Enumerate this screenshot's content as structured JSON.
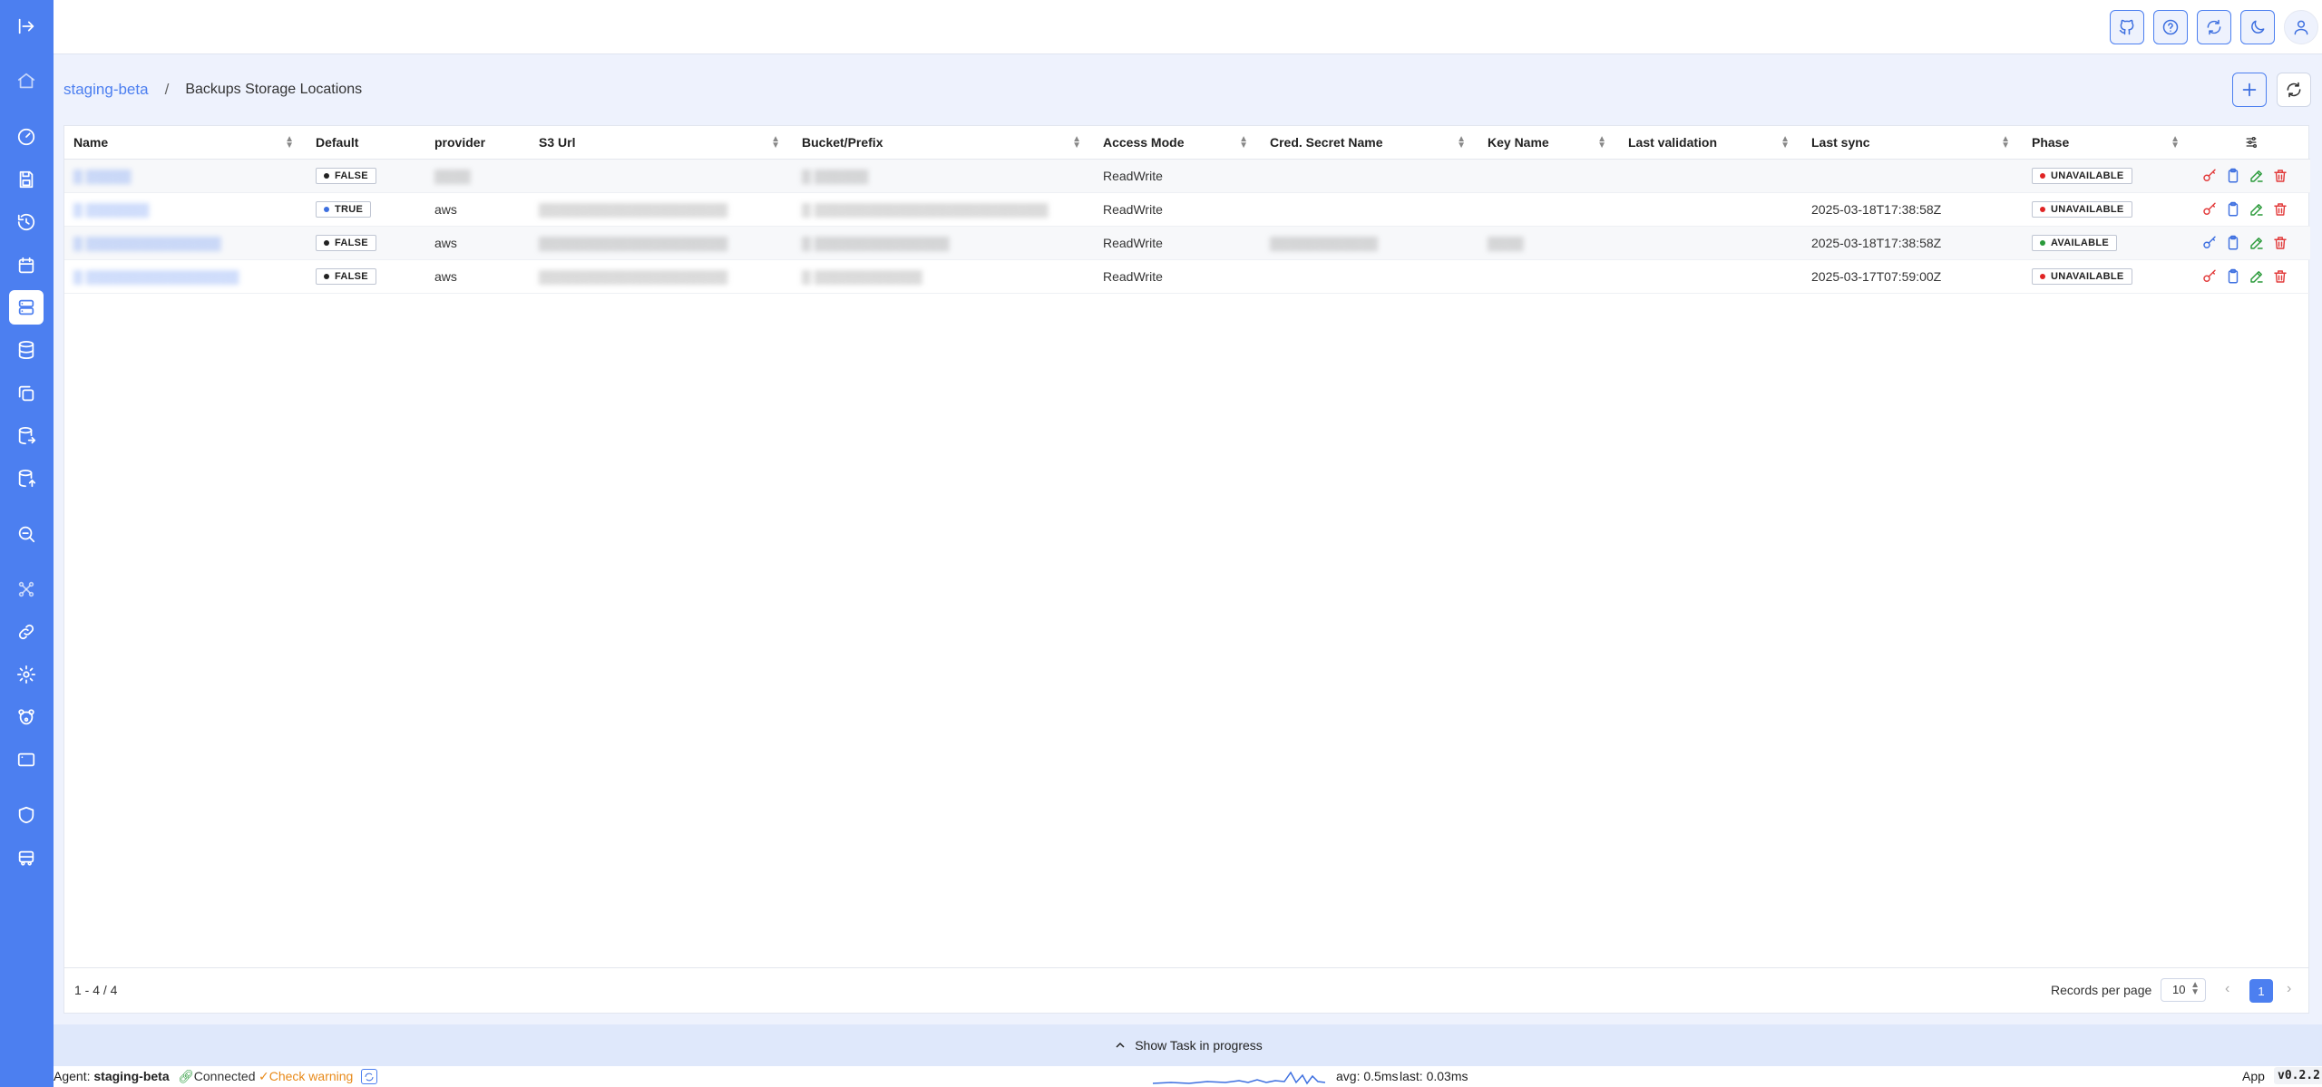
{
  "sidebar": {
    "items": [
      {
        "icon": "collapse-sidebar-icon"
      },
      {
        "icon": "home-icon"
      },
      {
        "icon": "dashboard-gauge-icon"
      },
      {
        "icon": "backup-save-icon"
      },
      {
        "icon": "restore-history-icon"
      },
      {
        "icon": "schedule-calendar-icon"
      },
      {
        "icon": "storage-locations-icon",
        "active": true
      },
      {
        "icon": "database-icon"
      },
      {
        "icon": "copies-icon"
      },
      {
        "icon": "database-export-icon"
      },
      {
        "icon": "database-import-icon"
      },
      {
        "icon": "inspect-search-icon"
      },
      {
        "icon": "network-nodes-icon"
      },
      {
        "icon": "link-icon"
      },
      {
        "icon": "settings-gear-icon"
      },
      {
        "icon": "bear-icon"
      },
      {
        "icon": "window-icon"
      },
      {
        "icon": "shield-icon"
      },
      {
        "icon": "vehicle-icon"
      }
    ]
  },
  "topbar": {
    "buttons": [
      "heart-icon",
      "github-icon",
      "help-icon",
      "sync-icon",
      "dark-mode-icon",
      "user-icon"
    ]
  },
  "breadcrumb": {
    "cluster": "staging-beta",
    "separator": "/",
    "page": "Backups Storage Locations"
  },
  "table": {
    "columns": [
      "Name",
      "Default",
      "provider",
      "S3 Url",
      "Bucket/Prefix",
      "Access Mode",
      "Cred. Secret Name",
      "Key Name",
      "Last validation",
      "Last sync",
      "Phase"
    ],
    "rows": [
      {
        "name": "▒ ▒▒▒▒▒",
        "default": "FALSE",
        "provider": "▒▒▒▒",
        "s3url": "",
        "bucket": "▒ ▒▒▒▒▒▒",
        "access": "ReadWrite",
        "cred": "",
        "key": "",
        "last_validation": "",
        "last_sync": "",
        "phase": "UNAVAILABLE"
      },
      {
        "name": "▒ ▒▒▒▒▒▒▒",
        "default": "TRUE",
        "provider": "aws",
        "s3url": "▒▒▒▒▒▒▒▒▒▒▒▒▒▒▒▒▒▒▒▒▒",
        "bucket": "▒ ▒▒▒▒▒▒▒▒▒▒▒▒▒▒▒▒▒▒▒▒▒▒▒▒▒▒",
        "access": "ReadWrite",
        "cred": "",
        "key": "",
        "last_validation": "",
        "last_sync": "2025-03-18T17:38:58Z",
        "phase": "UNAVAILABLE"
      },
      {
        "name": "▒ ▒▒▒▒▒▒▒▒▒▒▒▒▒▒▒",
        "default": "FALSE",
        "provider": "aws",
        "s3url": "▒▒▒▒▒▒▒▒▒▒▒▒▒▒▒▒▒▒▒▒▒",
        "bucket": "▒ ▒▒▒▒▒▒▒▒▒▒▒▒▒▒▒",
        "access": "ReadWrite",
        "cred": "▒▒▒▒▒▒▒▒▒▒▒▒",
        "key": "▒▒▒▒",
        "last_validation": "",
        "last_sync": "2025-03-18T17:38:58Z",
        "phase": "AVAILABLE"
      },
      {
        "name": "▒ ▒▒▒▒▒▒▒▒▒▒▒▒▒▒▒▒▒",
        "default": "FALSE",
        "provider": "aws",
        "s3url": "▒▒▒▒▒▒▒▒▒▒▒▒▒▒▒▒▒▒▒▒▒",
        "bucket": "▒ ▒▒▒▒▒▒▒▒▒▒▒▒",
        "access": "ReadWrite",
        "cred": "",
        "key": "",
        "last_validation": "",
        "last_sync": "2025-03-17T07:59:00Z",
        "phase": "UNAVAILABLE"
      }
    ]
  },
  "pagination": {
    "count": "1 - 4 / 4",
    "records_per_page_label": "Records per page",
    "records_per_page": "10",
    "current_page": "1",
    "prev": "‹",
    "next": "›"
  },
  "taskbar": {
    "label": "Show Task in progress"
  },
  "status": {
    "agent_label": "Agent:",
    "agent_name": "staging-beta",
    "connected": "Connected",
    "warning": "Check warning",
    "avg": "avg: 0.5ms",
    "last": "last: 0.03ms",
    "app": "App",
    "version": "v0.2.2"
  },
  "colors": {
    "sidebar": "#4c7ff0",
    "accent": "#4c7ff0",
    "unavailable_dot": "#e02424",
    "available_dot": "#2a9a3a",
    "true_dot": "#3d6fe0",
    "false_dot": "#222222",
    "warning": "#e88a1a"
  }
}
